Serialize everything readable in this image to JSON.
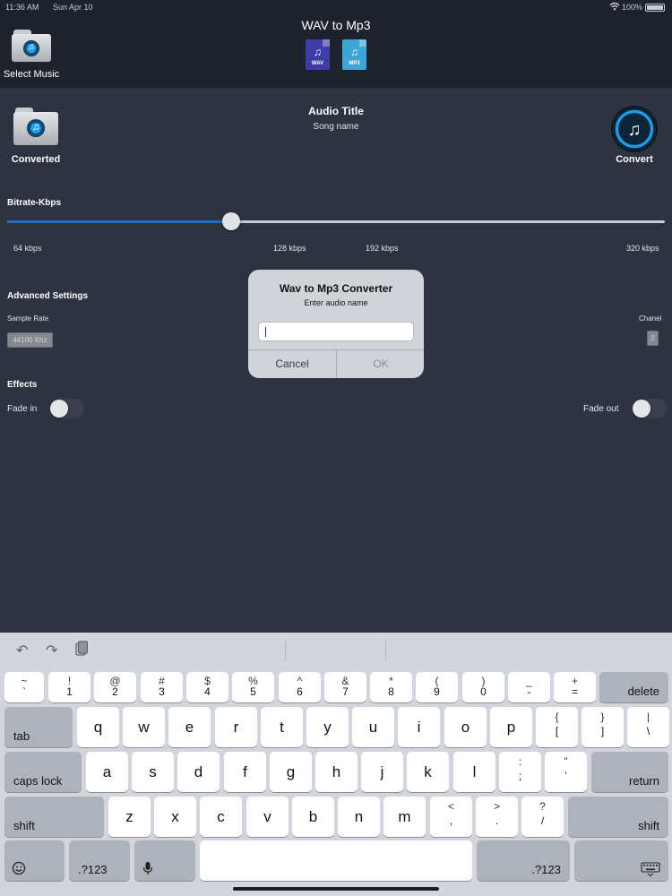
{
  "status_bar": {
    "time": "11:36 AM",
    "date": "Sun Apr 10",
    "battery": "100%"
  },
  "header": {
    "title": "WAV to Mp3",
    "select_music_label": "Select Music",
    "wav_icon_text": "WAV",
    "mp3_icon_text": "MP3"
  },
  "main": {
    "converted_label": "Converted",
    "audio_title": "Audio Title",
    "song_name": "Song name",
    "convert_label": "Convert",
    "bitrate": {
      "label": "Bitrate-Kbps",
      "ticks": [
        "64 kbps",
        "128 kbps",
        "192 kbps",
        "320 kbps"
      ],
      "value_fraction": 0.34
    },
    "advanced": {
      "label": "Advanced Settings",
      "sample_rate_label": "Sample Rate",
      "sample_rate_value": "44100 Khz",
      "channel_label": "Chanel",
      "channel_value": "2"
    },
    "effects": {
      "label": "Effects",
      "fade_in_label": "Fade in",
      "fade_out_label": "Fade out",
      "fade_in_on": false,
      "fade_out_on": false
    }
  },
  "dialog": {
    "title": "Wav to Mp3 Converter",
    "message": "Enter audio name",
    "input_value": "",
    "cancel_label": "Cancel",
    "ok_label": "OK"
  },
  "keyboard": {
    "toolbar_icons": [
      "undo-icon",
      "redo-icon",
      "paste-icon"
    ],
    "row1": [
      {
        "top": "~",
        "bottom": "`"
      },
      {
        "top": "!",
        "bottom": "1"
      },
      {
        "top": "@",
        "bottom": "2"
      },
      {
        "top": "#",
        "bottom": "3"
      },
      {
        "top": "$",
        "bottom": "4"
      },
      {
        "top": "%",
        "bottom": "5"
      },
      {
        "top": "^",
        "bottom": "6"
      },
      {
        "top": "&",
        "bottom": "7"
      },
      {
        "top": "*",
        "bottom": "8"
      },
      {
        "top": "(",
        "bottom": "9"
      },
      {
        "top": ")",
        "bottom": "0"
      },
      {
        "top": "_",
        "bottom": "-"
      },
      {
        "top": "+",
        "bottom": "="
      }
    ],
    "delete_label": "delete",
    "tab_label": "tab",
    "row2": [
      "q",
      "w",
      "e",
      "r",
      "t",
      "y",
      "u",
      "i",
      "o",
      "p"
    ],
    "row2_extra": [
      {
        "top": "{",
        "bottom": "["
      },
      {
        "top": "}",
        "bottom": "]"
      },
      {
        "top": "|",
        "bottom": "\\"
      }
    ],
    "caps_label": "caps lock",
    "row3": [
      "a",
      "s",
      "d",
      "f",
      "g",
      "h",
      "j",
      "k",
      "l"
    ],
    "row3_extra": [
      {
        "top": ":",
        "bottom": ";"
      },
      {
        "top": "”",
        "bottom": "’"
      }
    ],
    "return_label": "return",
    "shift_label": "shift",
    "row4": [
      "z",
      "x",
      "c",
      "v",
      "b",
      "n",
      "m"
    ],
    "row4_extra": [
      {
        "top": "<",
        "bottom": ","
      },
      {
        "top": ">",
        "bottom": "."
      },
      {
        "top": "?",
        "bottom": "/"
      }
    ],
    "numbers_label": ".?123",
    "emoji_icon": "emoji-icon",
    "mic_icon": "microphone-icon",
    "hide_icon": "keyboard-hide-icon"
  }
}
